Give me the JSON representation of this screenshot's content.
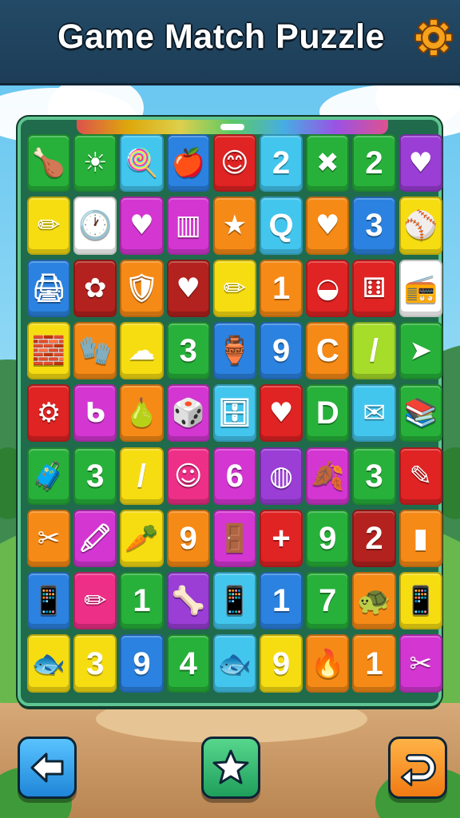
{
  "header": {
    "title": "Game Match Puzzle",
    "settings_icon": "gear-icon"
  },
  "colors": {
    "R": "#e02323",
    "G": "#27b13a",
    "B": "#2b82e0",
    "C": "#42c6ee",
    "Y": "#f6dd12",
    "O": "#f68a16",
    "P": "#d436d2",
    "V": "#9a3ed6",
    "K": "#ee2f87",
    "W": "#ffffff",
    "L": "#a6dc2a",
    "D": "#b3221e"
  },
  "board": {
    "rows": [
      [
        {
          "c": "G",
          "t": "🍗"
        },
        {
          "c": "G",
          "t": "☀"
        },
        {
          "c": "C",
          "t": "🍭"
        },
        {
          "c": "B",
          "t": "🍎"
        },
        {
          "c": "R",
          "t": "😊"
        },
        {
          "c": "C",
          "t": "2"
        },
        {
          "c": "G",
          "t": "✖"
        },
        {
          "c": "G",
          "t": "2"
        },
        {
          "c": "V",
          "t": "♥"
        }
      ],
      [
        {
          "c": "Y",
          "t": "✏"
        },
        {
          "c": "W",
          "t": "🕐"
        },
        {
          "c": "P",
          "t": "♥"
        },
        {
          "c": "P",
          "t": "▥"
        },
        {
          "c": "O",
          "t": "★"
        },
        {
          "c": "C",
          "t": "Q"
        },
        {
          "c": "O",
          "t": "♥"
        },
        {
          "c": "B",
          "t": "3"
        },
        {
          "c": "Y",
          "t": "⚾"
        }
      ],
      [
        {
          "c": "B",
          "t": "🖨"
        },
        {
          "c": "D",
          "t": "✿"
        },
        {
          "c": "O",
          "t": "🛡"
        },
        {
          "c": "D",
          "t": "♥"
        },
        {
          "c": "Y",
          "t": "✏"
        },
        {
          "c": "O",
          "t": "1"
        },
        {
          "c": "R",
          "t": "◒"
        },
        {
          "c": "R",
          "t": "⚅"
        },
        {
          "c": "W",
          "t": "📻"
        }
      ],
      [
        {
          "c": "Y",
          "t": "🧱"
        },
        {
          "c": "O",
          "t": "🧤"
        },
        {
          "c": "Y",
          "t": "☁"
        },
        {
          "c": "G",
          "t": "3"
        },
        {
          "c": "B",
          "t": "🏺"
        },
        {
          "c": "B",
          "t": "9"
        },
        {
          "c": "O",
          "t": "C"
        },
        {
          "c": "L",
          "t": "/"
        },
        {
          "c": "G",
          "t": "➤"
        }
      ],
      [
        {
          "c": "R",
          "t": "⚙"
        },
        {
          "c": "P",
          "t": "ᑲ"
        },
        {
          "c": "O",
          "t": "🍐"
        },
        {
          "c": "P",
          "t": "🎲"
        },
        {
          "c": "C",
          "t": "🗄"
        },
        {
          "c": "R",
          "t": "♥"
        },
        {
          "c": "G",
          "t": "D"
        },
        {
          "c": "C",
          "t": "✉"
        },
        {
          "c": "G",
          "t": "📚"
        }
      ],
      [
        {
          "c": "G",
          "t": "🧳"
        },
        {
          "c": "G",
          "t": "3"
        },
        {
          "c": "Y",
          "t": "/"
        },
        {
          "c": "K",
          "t": "☺"
        },
        {
          "c": "P",
          "t": "6"
        },
        {
          "c": "V",
          "t": "◍"
        },
        {
          "c": "P",
          "t": "🍂"
        },
        {
          "c": "G",
          "t": "3"
        },
        {
          "c": "R",
          "t": "✎"
        }
      ],
      [
        {
          "c": "O",
          "t": "✂"
        },
        {
          "c": "P",
          "t": "🖍"
        },
        {
          "c": "Y",
          "t": "🥕"
        },
        {
          "c": "O",
          "t": "9"
        },
        {
          "c": "P",
          "t": "🚪"
        },
        {
          "c": "R",
          "t": "+"
        },
        {
          "c": "G",
          "t": "9"
        },
        {
          "c": "D",
          "t": "2"
        },
        {
          "c": "O",
          "t": "▮"
        }
      ],
      [
        {
          "c": "B",
          "t": "📱"
        },
        {
          "c": "K",
          "t": "✏"
        },
        {
          "c": "G",
          "t": "1"
        },
        {
          "c": "V",
          "t": "🦴"
        },
        {
          "c": "C",
          "t": "📱"
        },
        {
          "c": "B",
          "t": "1"
        },
        {
          "c": "G",
          "t": "7"
        },
        {
          "c": "O",
          "t": "🐢"
        },
        {
          "c": "Y",
          "t": "📱"
        }
      ],
      [
        {
          "c": "Y",
          "t": "🐟"
        },
        {
          "c": "Y",
          "t": "3"
        },
        {
          "c": "B",
          "t": "9"
        },
        {
          "c": "G",
          "t": "4"
        },
        {
          "c": "C",
          "t": "🐟"
        },
        {
          "c": "Y",
          "t": "9"
        },
        {
          "c": "O",
          "t": "🔥"
        },
        {
          "c": "O",
          "t": "1"
        },
        {
          "c": "P",
          "t": "✂"
        }
      ]
    ]
  },
  "buttons": {
    "back_icon": "arrow-left-icon",
    "star_icon": "star-icon",
    "undo_icon": "undo-icon"
  }
}
